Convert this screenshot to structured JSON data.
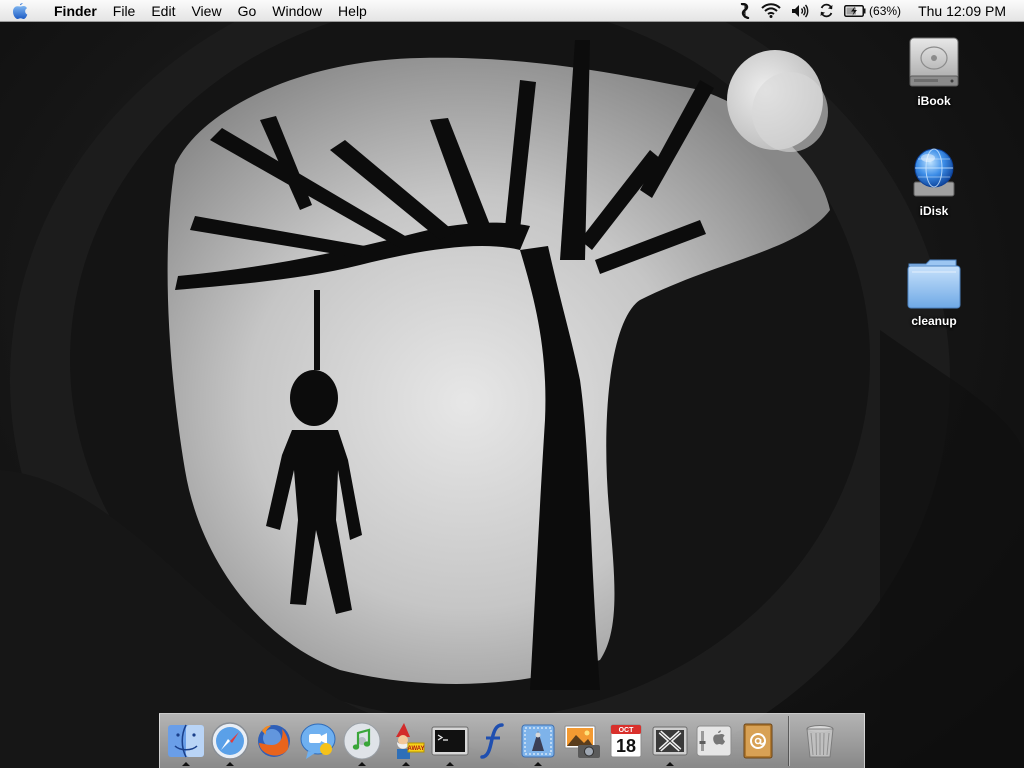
{
  "menubar": {
    "apple_icon": "apple-logo-icon",
    "app_name": "Finder",
    "menus": [
      "File",
      "Edit",
      "View",
      "Go",
      "Window",
      "Help"
    ],
    "extras": {
      "script_icon": "script-menu-icon",
      "wifi_icon": "wifi-icon",
      "volume_icon": "volume-icon",
      "sync_icon": "sync-icon",
      "battery_icon": "battery-icon",
      "battery_percent": "(63%)",
      "battery_level": 0.63,
      "clock": "Thu 12:09 PM"
    }
  },
  "desktop_icons": [
    {
      "label": "iBook",
      "icon": "hard-drive-icon"
    },
    {
      "label": "iDisk",
      "icon": "idisk-icon"
    },
    {
      "label": "cleanup",
      "icon": "folder-icon"
    }
  ],
  "dock": {
    "apps": [
      {
        "icon": "finder-icon",
        "running": true
      },
      {
        "icon": "safari-icon",
        "running": true
      },
      {
        "icon": "firefox-icon",
        "running": false
      },
      {
        "icon": "ichat-icon",
        "running": false
      },
      {
        "icon": "itunes-icon",
        "running": true
      },
      {
        "icon": "away-gnome-icon",
        "running": true
      },
      {
        "icon": "terminal-icon",
        "running": true
      },
      {
        "icon": "fontographer-icon",
        "running": false
      },
      {
        "icon": "mail-icon",
        "running": true
      },
      {
        "icon": "iphoto-icon",
        "running": false
      },
      {
        "icon": "ical-icon",
        "running": false,
        "month": "OCT",
        "day": "18"
      },
      {
        "icon": "x11-icon",
        "running": true
      },
      {
        "icon": "system-preferences-icon",
        "running": false
      },
      {
        "icon": "address-book-icon",
        "running": false
      }
    ],
    "trash_icon": "trash-icon"
  },
  "colors": {
    "menubar_bg": "#eeeeee",
    "label_text": "#ffffff",
    "wallpaper_dark": "#111111",
    "wallpaper_light": "#e6e6e6"
  }
}
